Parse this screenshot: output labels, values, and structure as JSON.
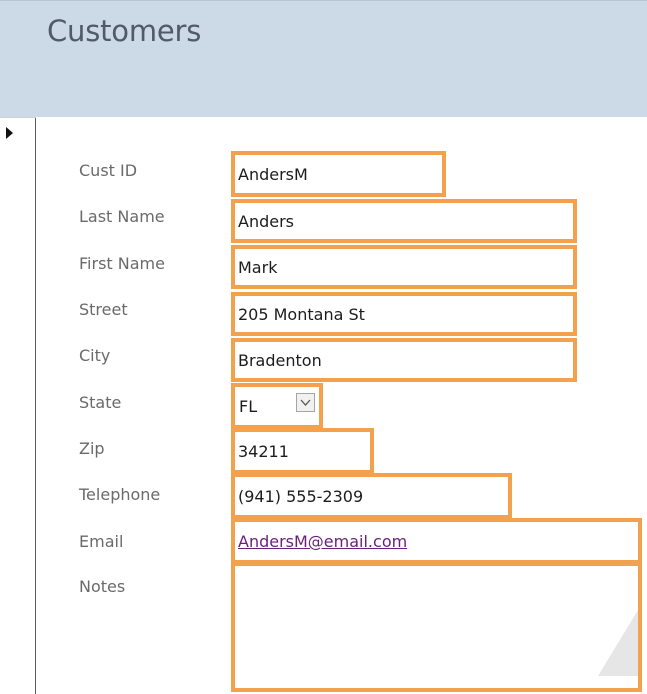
{
  "form": {
    "title": "Customers"
  },
  "fields": {
    "cust_id": {
      "label": "Cust ID",
      "value": "AndersM"
    },
    "last_name": {
      "label": "Last Name",
      "value": "Anders"
    },
    "first_name": {
      "label": "First Name",
      "value": "Mark"
    },
    "street": {
      "label": "Street",
      "value": "205 Montana St"
    },
    "city": {
      "label": "City",
      "value": "Bradenton"
    },
    "state": {
      "label": "State",
      "value": "FL"
    },
    "zip": {
      "label": "Zip",
      "value": "34211"
    },
    "telephone": {
      "label": "Telephone",
      "value": "(941) 555-2309"
    },
    "email": {
      "label": "Email",
      "value": "AndersM@email.com"
    },
    "notes": {
      "label": "Notes",
      "value": ""
    }
  },
  "colors": {
    "header_bg": "#ccd9e6",
    "field_highlight": "#f4a14d",
    "title": "#505b6a",
    "link": "#6a1f7a"
  },
  "icons": {
    "record_selector": "triangle-right-icon",
    "state_dropdown": "chevron-down-icon"
  }
}
